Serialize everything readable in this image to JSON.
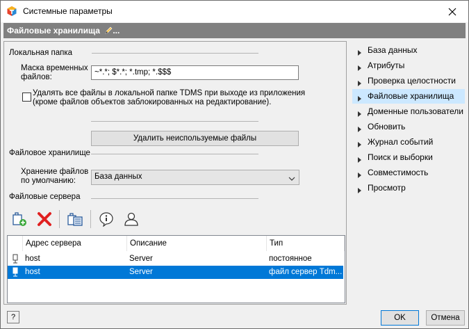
{
  "window": {
    "title": "Системные параметры"
  },
  "header": {
    "title": "Файловые хранилища",
    "edit_marker": "..."
  },
  "local_folder": {
    "group_label": "Локальная папка",
    "mask_label_line1": "Маска временных",
    "mask_label_line2": "файлов:",
    "mask_value": "~*.*; $*.*; *.tmp; *.$$$",
    "delete_all_line1": "Удалять все файлы в локальной папке TDMS при выходе из приложения",
    "delete_all_line2": "(кроме файлов объектов заблокированных на редактирование).",
    "delete_all_checked": false,
    "delete_unused_button": "Удалить неиспользуемые файлы"
  },
  "file_storage": {
    "group_label": "Файловое хранилище",
    "storage_label_line1": "Хранение файлов",
    "storage_label_line2": "по умолчанию:",
    "storage_value": "База данных"
  },
  "file_servers": {
    "group_label": "Файловые сервера",
    "toolbar": [
      "add-server-icon",
      "delete-icon",
      "server-properties-icon",
      "info-icon",
      "user-icon"
    ],
    "columns": [
      "Адрес сервера",
      "Описание",
      "Тип"
    ],
    "rows": [
      {
        "address": "host",
        "description": "Server",
        "type": "постоянное",
        "selected": false
      },
      {
        "address": "host",
        "description": "Server",
        "type": "файл сервер Tdm...",
        "selected": true
      }
    ]
  },
  "nav": {
    "items": [
      {
        "label": "База данных",
        "selected": false
      },
      {
        "label": "Атрибуты",
        "selected": false
      },
      {
        "label": "Проверка целостности",
        "selected": false
      },
      {
        "label": "Файловые хранилища",
        "selected": true
      },
      {
        "label": "Доменные пользователи",
        "selected": false
      },
      {
        "label": "Обновить",
        "selected": false
      },
      {
        "label": "Журнал событий",
        "selected": false
      },
      {
        "label": "Поиск и выборки",
        "selected": false
      },
      {
        "label": "Совместимость",
        "selected": false
      },
      {
        "label": "Просмотр",
        "selected": false
      }
    ]
  },
  "footer": {
    "help": "?",
    "ok": "OK",
    "cancel": "Отмена"
  },
  "colors": {
    "accent": "#0078d7",
    "selected_nav": "#cce8ff",
    "header_bg": "#808080"
  }
}
